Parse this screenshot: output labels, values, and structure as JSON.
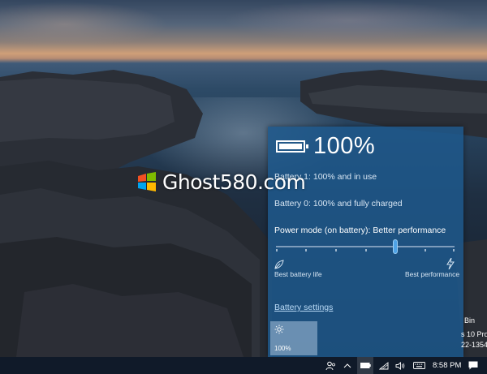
{
  "battery": {
    "percent_label": "100%",
    "level": 1.0,
    "line1": "Battery 1: 100% and in use",
    "line2": "Battery 0: 100% and fully charged"
  },
  "power_mode": {
    "label": "Power mode (on battery): Better performance",
    "slider_position": 0.67,
    "left_label": "Best battery life",
    "right_label": "Best performance",
    "left_icon": "leaf-icon",
    "right_icon": "lightning-bolt-icon"
  },
  "settings_link": "Battery settings",
  "quick_action": {
    "label": "100%",
    "icon": "brightness-icon"
  },
  "watermark": {
    "text": "Ghost580.com"
  },
  "desktop_text": {
    "line1": "Bin",
    "line2": "s 10 Pro",
    "line3": "22-1354"
  },
  "taskbar": {
    "clock": "8:58 PM",
    "icons": [
      "people-icon",
      "chevron-up-icon",
      "battery-icon",
      "wifi-icon",
      "volume-icon",
      "keyboard-icon",
      "notifications-icon"
    ]
  },
  "colors": {
    "flyout": "#1e588c",
    "accent": "#4fa3e6",
    "taskbar": "#101a29"
  }
}
